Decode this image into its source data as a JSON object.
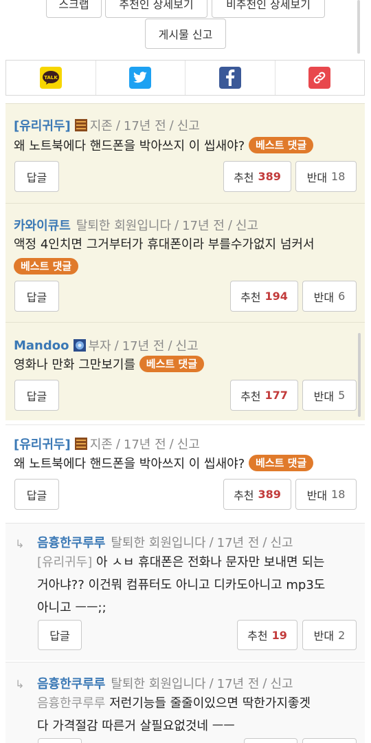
{
  "top_buttons": {
    "scrap": "스크랩",
    "voters_detail": "추천인 상세보기",
    "nonvoters_detail": "비추천인 상세보기",
    "report_post": "게시물 신고"
  },
  "share": {
    "icons": [
      "kakaotalk-icon",
      "twitter-icon",
      "facebook-icon",
      "link-icon"
    ],
    "kakao_label": "TALK",
    "colors": {
      "kakao": "#f7d600",
      "twitter": "#1da1f2",
      "facebook": "#3b5998",
      "link": "#e8484d"
    }
  },
  "labels": {
    "reply": "답글",
    "up": "추천",
    "down": "반대",
    "best": "베스트 댓글",
    "report": "신고",
    "sep": "/"
  },
  "comments": [
    {
      "author": "[유리귀두]",
      "rank": "지존",
      "time": "17년 전",
      "text": "왜 노트북에다 핸드폰을 박아쓰지 이 씹새야?",
      "up": "389",
      "down": "18"
    },
    {
      "author": "카와이큐트",
      "rank": "탈퇴한 회원입니다",
      "time": "17년 전",
      "text": "액정 4인치면 그거부터가 휴대폰이라 부를수가없지 넘커서",
      "up": "194",
      "down": "6"
    },
    {
      "author": "Mandoo",
      "rank": "부자",
      "time": "17년 전",
      "text": "영화나 만화 그만보기를",
      "up": "177",
      "down": "5"
    },
    {
      "author": "[유리귀두]",
      "rank": "지존",
      "time": "17년 전",
      "text": "왜 노트북에다 핸드폰을 박아쓰지 이 씹새야?",
      "up": "389",
      "down": "18"
    },
    {
      "author": "음흉한쿠루루",
      "rank": "탈퇴한 회원입니다",
      "time": "17년 전",
      "quote": "[유리귀두]",
      "line1": "아 ㅅㅂ 휴대폰은 전화나 문자만 보내면 되는",
      "line2": "거아냐?? 이건뭐 컴퓨터도 아니고 디카도아니고 mp3도",
      "line3": "아니고 ㅡㅡ;;",
      "up": "19",
      "down": "2"
    },
    {
      "author": "음흉한쿠루루",
      "rank": "탈퇴한 회원입니다",
      "time": "17년 전",
      "quote": "음흉한쿠루루",
      "line1": "저런기능들 줄줄이있으면 딱한가지좋겟",
      "line2": "다 가격절감 따른거 살필요없것네 ㅡㅡ"
    }
  ]
}
